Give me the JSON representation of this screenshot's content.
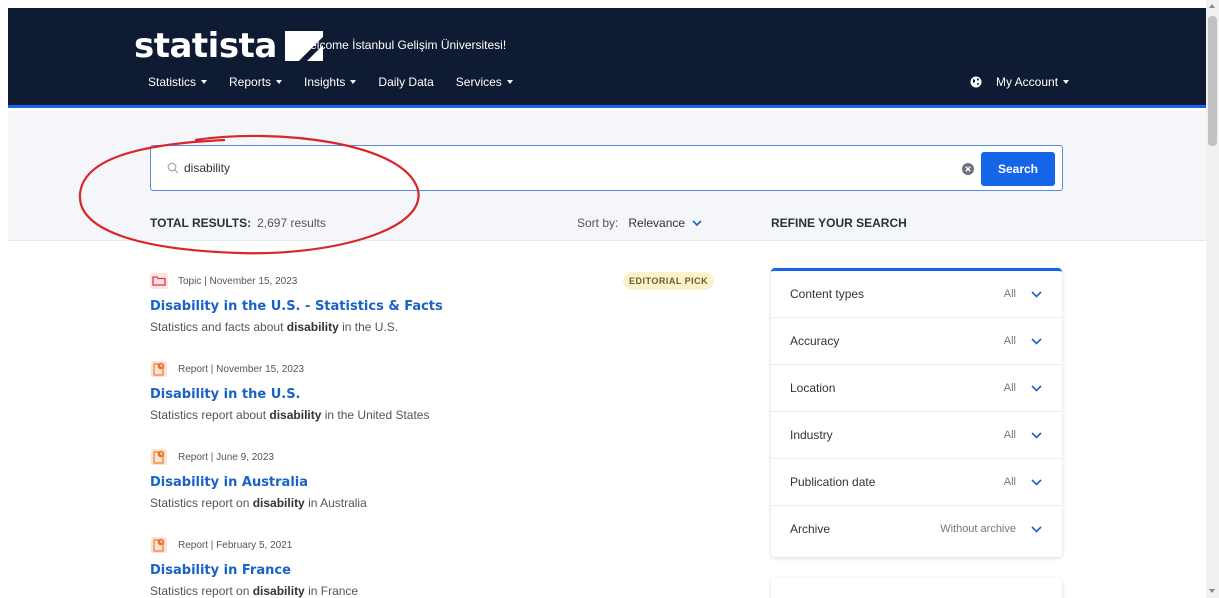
{
  "header": {
    "logo_text": "statista",
    "welcome": "Welcome İstanbul Gelişim Üniversitesi!",
    "nav": [
      {
        "label": "Statistics",
        "dropdown": true
      },
      {
        "label": "Reports",
        "dropdown": true
      },
      {
        "label": "Insights",
        "dropdown": true
      },
      {
        "label": "Daily Data",
        "dropdown": false
      },
      {
        "label": "Services",
        "dropdown": true
      }
    ],
    "account_label": "My Account",
    "account_icon": "globe-icon",
    "bg_color": "#0f1b33",
    "accent_color": "#1565e8"
  },
  "search": {
    "value": "disability",
    "button_label": "Search",
    "icon": "search-icon",
    "clear_icon": "clear-icon"
  },
  "results_bar": {
    "total_label": "TOTAL RESULTS:",
    "total_count": "2,697 results",
    "sort_label": "Sort by:",
    "sort_value": "Relevance",
    "refine_label": "REFINE YOUR SEARCH"
  },
  "editorial_badge": "EDITORIAL PICK",
  "results": [
    {
      "type_icon": "folder-icon",
      "meta": "Topic | November 15, 2023",
      "title": "Disability in the U.S. - Statistics & Facts",
      "desc_before": "Statistics and facts about ",
      "desc_bold": "disability",
      "desc_after": " in the U.S."
    },
    {
      "type_icon": "report-icon",
      "meta": "Report | November 15, 2023",
      "title": "Disability in the U.S.",
      "desc_before": "Statistics report about ",
      "desc_bold": "disability",
      "desc_after": " in the United States"
    },
    {
      "type_icon": "report-icon",
      "meta": "Report | June 9, 2023",
      "title": "Disability in Australia",
      "desc_before": "Statistics report on ",
      "desc_bold": "disability",
      "desc_after": " in Australia"
    },
    {
      "type_icon": "report-icon",
      "meta": "Report | February 5, 2021",
      "title": "Disability in France",
      "desc_before": "Statistics report on ",
      "desc_bold": "disability",
      "desc_after": " in France"
    }
  ],
  "filters": [
    {
      "label": "Content types",
      "value": "All"
    },
    {
      "label": "Accuracy",
      "value": "All"
    },
    {
      "label": "Location",
      "value": "All"
    },
    {
      "label": "Industry",
      "value": "All"
    },
    {
      "label": "Publication date",
      "value": "All"
    },
    {
      "label": "Archive",
      "value": "Without archive"
    }
  ],
  "annotation_color": "#d9262a"
}
